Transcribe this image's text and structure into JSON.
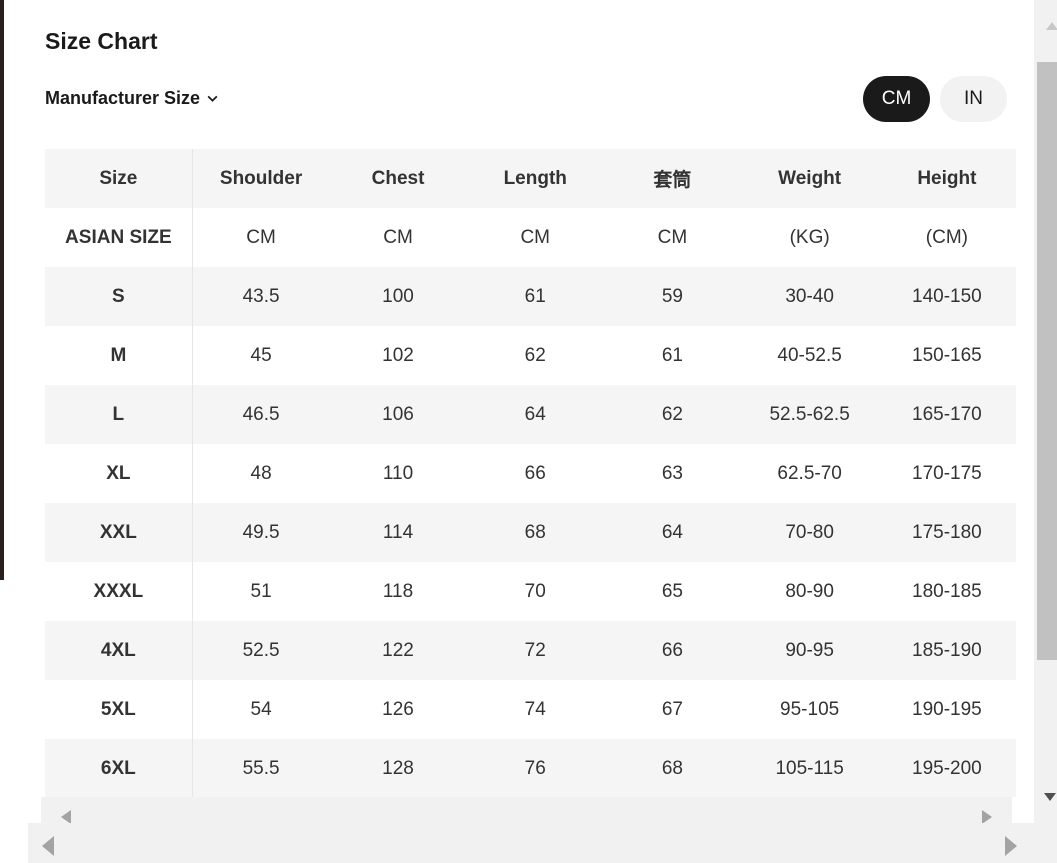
{
  "title": "Size Chart",
  "manufacturer_size_label": "Manufacturer Size",
  "unit_toggle": {
    "cm": "CM",
    "in": "IN",
    "selected": "CM"
  },
  "table": {
    "headers": [
      "Size",
      "Shoulder",
      "Chest",
      "Length",
      "套筒",
      "Weight",
      "Height"
    ],
    "rows": [
      [
        "ASIAN SIZE",
        "CM",
        "CM",
        "CM",
        "CM",
        "(KG)",
        "(CM)"
      ],
      [
        "S",
        "43.5",
        "100",
        "61",
        "59",
        "30-40",
        "140-150"
      ],
      [
        "M",
        "45",
        "102",
        "62",
        "61",
        "40-52.5",
        "150-165"
      ],
      [
        "L",
        "46.5",
        "106",
        "64",
        "62",
        "52.5-62.5",
        "165-170"
      ],
      [
        "XL",
        "48",
        "110",
        "66",
        "63",
        "62.5-70",
        "170-175"
      ],
      [
        "XXL",
        "49.5",
        "114",
        "68",
        "64",
        "70-80",
        "175-180"
      ],
      [
        "XXXL",
        "51",
        "118",
        "70",
        "65",
        "80-90",
        "180-185"
      ],
      [
        "4XL",
        "52.5",
        "122",
        "72",
        "66",
        "90-95",
        "185-190"
      ],
      [
        "5XL",
        "54",
        "126",
        "74",
        "67",
        "95-105",
        "190-195"
      ],
      [
        "6XL",
        "55.5",
        "128",
        "76",
        "68",
        "105-115",
        "195-200"
      ]
    ]
  },
  "colors": {
    "accent": "#1a1a1a",
    "row_alt": "#f5f5f5",
    "scrollbar_track": "#f1f1f1",
    "scrollbar_thumb": "#c1c1c1"
  }
}
